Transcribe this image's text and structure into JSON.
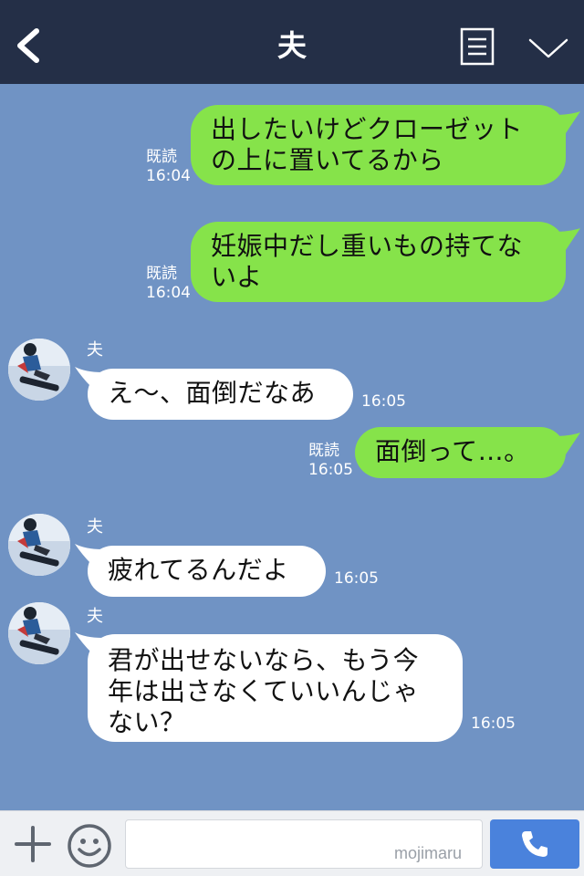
{
  "header": {
    "title": "夫",
    "back_icon": "chevron-left-icon",
    "menu_icon": "menu-list-icon",
    "collapse_icon": "chevron-down-icon",
    "background": "#242f47"
  },
  "chat": {
    "background": "#7093c4",
    "messages": [
      {
        "side": "out",
        "text_lines": [
          "出したいけどクローゼット",
          "の上に置いてるから"
        ],
        "read": "既読",
        "time": "16:04"
      },
      {
        "side": "out",
        "text_lines": [
          "妊娠中だし重いもの持てな",
          "いよ"
        ],
        "read": "既読",
        "time": "16:04"
      },
      {
        "side": "in",
        "sender": "夫",
        "text_lines": [
          "え〜、面倒だなあ"
        ],
        "time": "16:05"
      },
      {
        "side": "out",
        "text_lines": [
          "面倒って…。"
        ],
        "read": "既読",
        "time": "16:05"
      },
      {
        "side": "in",
        "sender": "夫",
        "text_lines": [
          "疲れてるんだよ"
        ],
        "time": "16:05"
      },
      {
        "side": "in",
        "sender": "夫",
        "text_lines": [
          "君が出せないなら、もう今",
          "年は出さなくていいんじゃ",
          "ない？"
        ],
        "time": "16:05"
      }
    ],
    "outgoing_bubble_color": "#86e34a",
    "incoming_bubble_color": "#ffffff"
  },
  "footer": {
    "plus_icon": "plus-icon",
    "emoji_icon": "smile-icon",
    "input_value": "",
    "watermark": "mojimaru",
    "call_icon": "phone-icon",
    "call_button_color": "#4a82dc"
  }
}
